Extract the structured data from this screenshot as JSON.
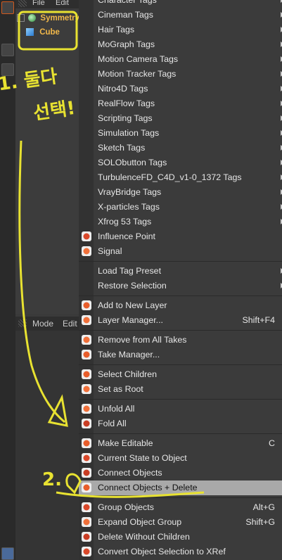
{
  "object_manager": {
    "menu": [
      "File",
      "Edit"
    ],
    "tree": [
      {
        "label": "Symmetry",
        "icon": "symmetry-icon"
      },
      {
        "label": "Cube",
        "icon": "cube-icon"
      }
    ]
  },
  "attribute_manager": {
    "menu": [
      "Mode",
      "Edit"
    ]
  },
  "context_menu": {
    "tag_submenus": [
      "Character Tags",
      "Cineman Tags",
      "Hair Tags",
      "MoGraph Tags",
      "Motion Camera Tags",
      "Motion Tracker Tags",
      "Nitro4D Tags",
      "RealFlow Tags",
      "Scripting Tags",
      "Simulation Tags",
      "Sketch Tags",
      "SOLObutton Tags",
      "TurbulenceFD_C4D_v1-0_1372 Tags",
      "VrayBridge Tags",
      "X-particles Tags",
      "Xfrog 53 Tags"
    ],
    "icon_items": [
      {
        "label": "Influence Point",
        "icon": "influence-point-icon"
      },
      {
        "label": "Signal",
        "icon": "signal-icon"
      }
    ],
    "preset_items": [
      {
        "label": "Load Tag Preset"
      },
      {
        "label": "Restore Selection"
      }
    ],
    "layer_items": [
      {
        "label": "Add to New Layer",
        "icon": "add-layer-icon",
        "shortcut": ""
      },
      {
        "label": "Layer Manager...",
        "icon": "layer-manager-icon",
        "shortcut": "Shift+F4"
      }
    ],
    "take_items": [
      {
        "label": "Remove from All Takes",
        "icon": "remove-takes-icon",
        "shortcut": ""
      },
      {
        "label": "Take Manager...",
        "icon": "take-manager-icon",
        "shortcut": ""
      }
    ],
    "select_items": [
      {
        "label": "Select Children",
        "icon": "select-children-icon"
      },
      {
        "label": "Set as Root",
        "icon": "set-root-icon"
      }
    ],
    "fold_items": [
      {
        "label": "Unfold All",
        "icon": "unfold-icon"
      },
      {
        "label": "Fold All",
        "icon": "fold-icon"
      }
    ],
    "edit_items": [
      {
        "label": "Make Editable",
        "icon": "make-editable-icon",
        "shortcut": "C"
      },
      {
        "label": "Current State to Object",
        "icon": "current-state-icon",
        "shortcut": ""
      },
      {
        "label": "Connect Objects",
        "icon": "connect-icon",
        "shortcut": ""
      },
      {
        "label": "Connect Objects + Delete",
        "icon": "connect-delete-icon",
        "shortcut": "",
        "highlighted": true
      }
    ],
    "group_items": [
      {
        "label": "Group Objects",
        "icon": "group-icon",
        "shortcut": "Alt+G"
      },
      {
        "label": "Expand Object Group",
        "icon": "expand-group-icon",
        "shortcut": "Shift+G"
      },
      {
        "label": "Delete Without Children",
        "icon": "delete-without-children-icon",
        "shortcut": ""
      },
      {
        "label": "Convert Object Selection to XRef",
        "icon": "xref-icon",
        "shortcut": ""
      }
    ]
  },
  "annotations": {
    "step1_text": "1. 둘다 선택!",
    "step2_text": "2.",
    "color": "#e8e231"
  }
}
